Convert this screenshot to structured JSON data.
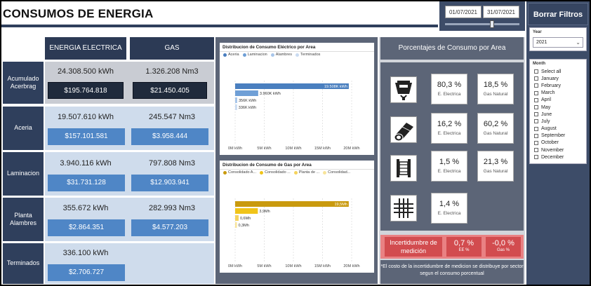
{
  "header": {
    "title": "CONSUMOS DE ENERGIA"
  },
  "date_filter": {
    "from": "01/07/2021",
    "to": "31/07/2021"
  },
  "sidebar": {
    "clear_button": "Borrar Filtros",
    "year_label": "Year",
    "year_value": "2021",
    "month_label": "Month",
    "months": [
      "Select all",
      "January",
      "February",
      "March",
      "April",
      "May",
      "June",
      "July",
      "August",
      "September",
      "October",
      "November",
      "December"
    ]
  },
  "table": {
    "col_elec": "ENERGIA ELECTRICA",
    "col_gas": "GAS",
    "rows": [
      {
        "label": "Acumulado Acerbrag",
        "elec_kwh": "24.308.500 kWh",
        "elec_cost": "$195.764.818",
        "gas_nm3": "1.326.208 Nm3",
        "gas_cost": "$21.450.405"
      },
      {
        "label": "Aceria",
        "elec_kwh": "19.507.610 kWh",
        "elec_cost": "$157.101.581",
        "gas_nm3": "245.547 Nm3",
        "gas_cost": "$3.958.444"
      },
      {
        "label": "Laminacion",
        "elec_kwh": "3.940.116 kWh",
        "elec_cost": "$31.731.128",
        "gas_nm3": "797.808 Nm3",
        "gas_cost": "$12.903.941"
      },
      {
        "label": "Planta Alambres",
        "elec_kwh": "355.672 kWh",
        "elec_cost": "$2.864.351",
        "gas_nm3": "282.993 Nm3",
        "gas_cost": "$4.577.203"
      },
      {
        "label": "Terminados",
        "elec_kwh": "336.100 kWh",
        "elec_cost": "$2.706.727"
      }
    ]
  },
  "chart_data": [
    {
      "type": "bar",
      "orientation": "horizontal",
      "title": "Distribucion de Consumo Eléctrico por Area",
      "categories": [
        "Aceria",
        "Laminacion",
        "Alambres",
        "Terminados"
      ],
      "values": [
        19508000,
        3960000,
        356000,
        336000
      ],
      "data_labels": [
        "19.508K kWh",
        "3.960K kWh",
        "356K kWh",
        "336K kWh"
      ],
      "colors": [
        "#4a7fbf",
        "#6f9fd6",
        "#a8c6ea",
        "#c9dbf1"
      ],
      "xlim": [
        0,
        20000000
      ],
      "ticks": [
        "0M kWh",
        "5M kWh",
        "10M kWh",
        "15M kWh",
        "20M kWh"
      ],
      "legend": "top-left"
    },
    {
      "type": "bar",
      "orientation": "horizontal",
      "title": "Distribucion de Consumo de Gas por Area",
      "categories": [
        "Consolidado A...",
        "Consolidado ...",
        "Planta de ...",
        "Consolidad..."
      ],
      "values": [
        19.5,
        3.9,
        0.6,
        0.3
      ],
      "data_labels": [
        "19,5Mh",
        "3,9Mh",
        "0,6Mh",
        "0,3Mh"
      ],
      "colors": [
        "#c99a0e",
        "#f0c419",
        "#f5d35c",
        "#f8e49a"
      ],
      "xlim": [
        0,
        20
      ],
      "ticks": [
        "0M kWh",
        "5M kWh",
        "10M kWh",
        "15M kWh",
        "20M kWh"
      ],
      "legend": "top-left"
    }
  ],
  "percentages": {
    "title": "Porcentajes de Consumo por Area",
    "rows": [
      {
        "icon": "furnace-icon",
        "elec": "80,3 %",
        "elec_label": "E. Electrica",
        "gas": "18,5 %",
        "gas_label": "Gas Natural"
      },
      {
        "icon": "coil-roll-icon",
        "elec": "16,2 %",
        "elec_label": "E. Electrica",
        "gas": "60,2 %",
        "gas_label": "Gas Natural"
      },
      {
        "icon": "wire-spool-icon",
        "elec": "1,5 %",
        "elec_label": "E. Electrica",
        "gas": "21,3 %",
        "gas_label": "Gas Natural"
      },
      {
        "icon": "mesh-grid-icon",
        "elec": "1,4 %",
        "elec_label": "E. Electrica"
      }
    ],
    "uncertainty": {
      "label": "Incertidumbre de medición",
      "elec": "0,7 %",
      "elec_label": "EE %",
      "gas": "-0,0 %",
      "gas_label": "Gas %"
    },
    "note": "*El costo de la incertidumbre de medicion se distribuye por sector segun el consumo porcentual"
  },
  "colors": {
    "navy": "#2f3f5c",
    "blue_box": "#4f86c6",
    "dark_box": "#1f2a3c",
    "slate": "#5c6577",
    "red": "#d24c4f"
  }
}
